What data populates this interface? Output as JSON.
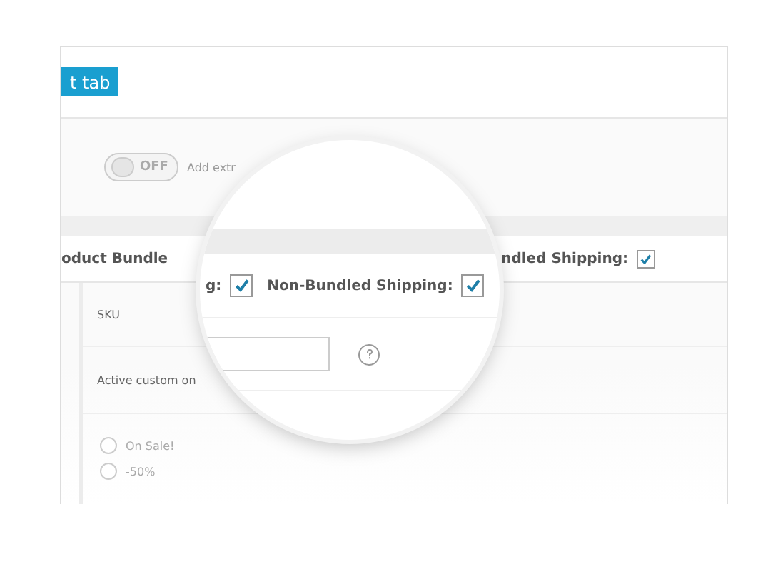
{
  "tab_button": {
    "label": "t tab"
  },
  "toggle": {
    "on": false,
    "label": "OFF",
    "description": "Add extr"
  },
  "bundle": {
    "title": "oduct Bundle",
    "shipping_label": "ndled Shipping:",
    "shipping_checked": true
  },
  "sku": {
    "label": "SKU"
  },
  "custom": {
    "label": "Active custom on"
  },
  "options": [
    {
      "label": "On Sale!",
      "selected": false
    },
    {
      "label": "-50%",
      "selected": false
    }
  ],
  "magnifier": {
    "left_label": "g:",
    "left_checked": true,
    "label": "Non-Bundled Shipping:",
    "checked": true
  }
}
